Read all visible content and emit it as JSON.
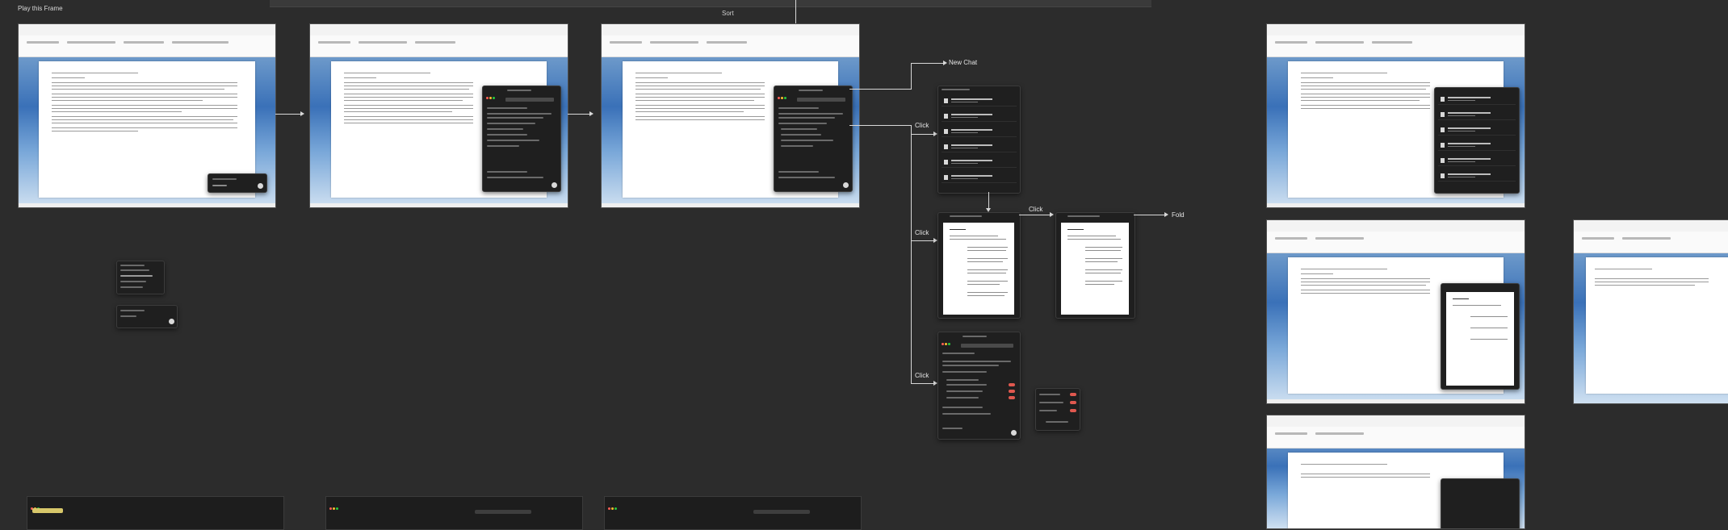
{
  "frame_title": "Play this Frame",
  "sort_label": "Sort",
  "flow": {
    "new_chat": "New Chat",
    "click": "Click",
    "fold": "Fold"
  },
  "colors": {
    "canvas": "#2c2c2c",
    "connector": "#d8d8d8",
    "panel": "#1f1f1f",
    "toggle_on": "#e0584f"
  },
  "icons": [
    "arrow-right-icon",
    "send-icon",
    "document-icon",
    "toggle-icon",
    "window-dots-icon"
  ]
}
